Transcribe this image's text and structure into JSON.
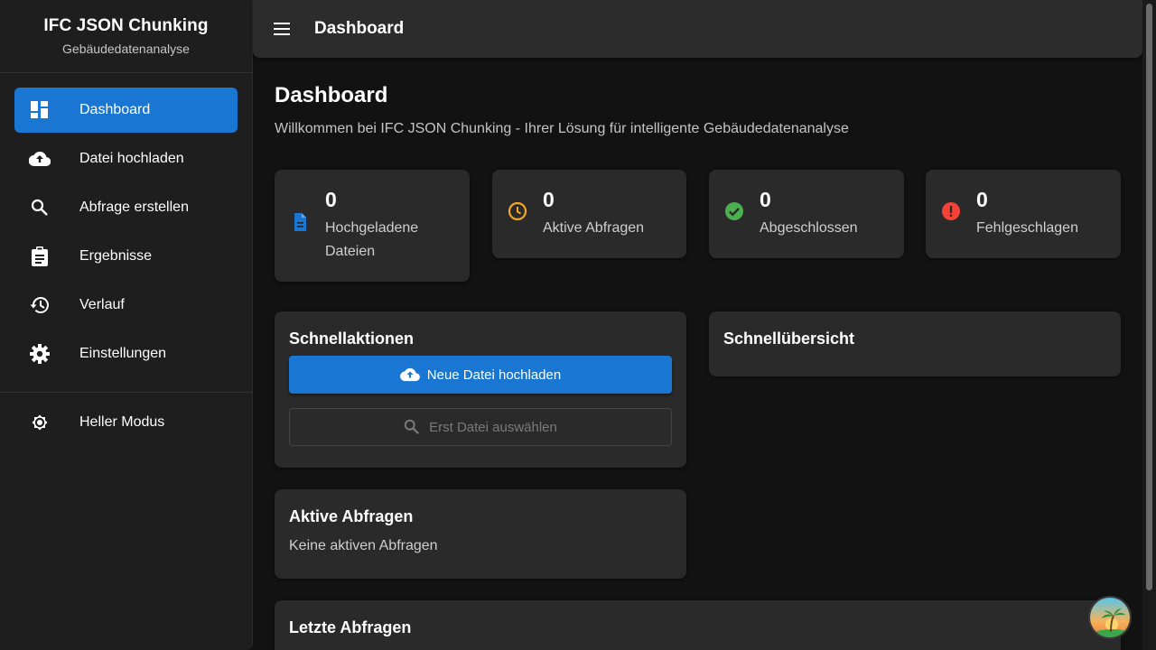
{
  "sidebar": {
    "title": "IFC JSON Chunking",
    "subtitle": "Gebäudedatenanalyse",
    "items": [
      {
        "label": "Dashboard",
        "icon": "dashboard-icon",
        "active": true
      },
      {
        "label": "Datei hochladen",
        "icon": "cloud-upload-icon",
        "active": false
      },
      {
        "label": "Abfrage erstellen",
        "icon": "search-icon",
        "active": false
      },
      {
        "label": "Ergebnisse",
        "icon": "clipboard-icon",
        "active": false
      },
      {
        "label": "Verlauf",
        "icon": "history-icon",
        "active": false
      },
      {
        "label": "Einstellungen",
        "icon": "gear-icon",
        "active": false
      }
    ],
    "mode_toggle": {
      "label": "Heller Modus",
      "icon": "brightness-icon"
    }
  },
  "topbar": {
    "title": "Dashboard",
    "menu_icon": "menu-icon"
  },
  "main": {
    "title": "Dashboard",
    "subtitle": "Willkommen bei IFC JSON Chunking - Ihrer Lösung für intelligente Gebäudedatenanalyse",
    "stats": [
      {
        "value": "0",
        "label": "Hochgeladene Dateien",
        "icon": "file-icon",
        "color": "#1976d2"
      },
      {
        "value": "0",
        "label": "Aktive Abfragen",
        "icon": "clock-icon",
        "color": "#f5a623"
      },
      {
        "value": "0",
        "label": "Abgeschlossen",
        "icon": "check-circle-icon",
        "color": "#4caf50"
      },
      {
        "value": "0",
        "label": "Fehlgeschlagen",
        "icon": "error-icon",
        "color": "#f44336"
      }
    ],
    "quick_actions": {
      "title": "Schnellaktionen",
      "upload_label": "Neue Datei hochladen",
      "query_label": "Erst Datei auswählen"
    },
    "overview": {
      "title": "Schnellübersicht"
    },
    "active_queries": {
      "title": "Aktive Abfragen",
      "empty_text": "Keine aktiven Abfragen"
    },
    "recent_queries": {
      "title": "Letzte Abfragen"
    }
  },
  "colors": {
    "accent": "#1976d2",
    "background": "#121212",
    "card": "#2a2a2a"
  }
}
